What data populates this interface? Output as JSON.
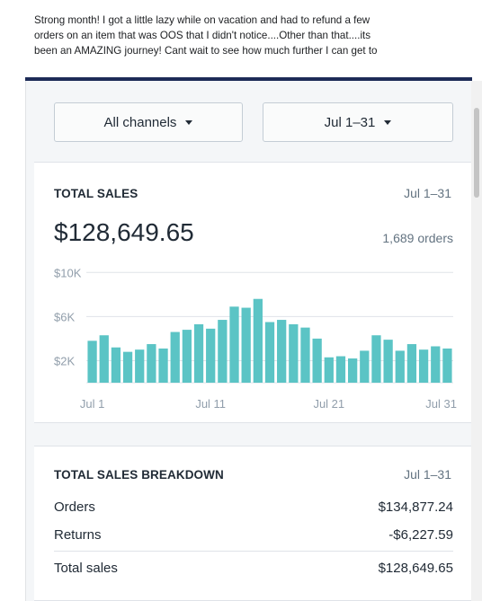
{
  "post": {
    "lines": [
      "Strong month! I got a little lazy while on vacation and had to refund a few",
      "orders on an item that was OOS that I didn't notice....Other than that....its",
      "been an AMAZING journey! Cant wait to see how much further I can get to"
    ]
  },
  "filters": {
    "channel": "All channels",
    "date_range": "Jul 1–31"
  },
  "total_sales": {
    "title": "TOTAL SALES",
    "date": "Jul 1–31",
    "amount": "$128,649.65",
    "orders": "1,689 orders"
  },
  "chart_data": {
    "type": "bar",
    "categories": [
      "Jul 1",
      "Jul 2",
      "Jul 3",
      "Jul 4",
      "Jul 5",
      "Jul 6",
      "Jul 7",
      "Jul 8",
      "Jul 9",
      "Jul 10",
      "Jul 11",
      "Jul 12",
      "Jul 13",
      "Jul 14",
      "Jul 15",
      "Jul 16",
      "Jul 17",
      "Jul 18",
      "Jul 19",
      "Jul 20",
      "Jul 21",
      "Jul 22",
      "Jul 23",
      "Jul 24",
      "Jul 25",
      "Jul 26",
      "Jul 27",
      "Jul 28",
      "Jul 29",
      "Jul 30",
      "Jul 31"
    ],
    "values": [
      3800,
      4300,
      3200,
      2800,
      3000,
      3500,
      3100,
      4600,
      4800,
      5300,
      4900,
      5700,
      6900,
      6800,
      7600,
      5500,
      5700,
      5300,
      5000,
      4000,
      2300,
      2400,
      2200,
      2900,
      4300,
      3900,
      2900,
      3500,
      3000,
      3300,
      3100
    ],
    "x_tick_labels": [
      "Jul 1",
      "Jul 11",
      "Jul 21",
      "Jul 31"
    ],
    "y_tick_labels": [
      "$10K",
      "$6K",
      "$2K"
    ],
    "y_ticks": [
      10000,
      6000,
      2000
    ],
    "ylim": [
      0,
      11000
    ],
    "bar_color": "#5bc4c5",
    "grid": true
  },
  "breakdown": {
    "title": "TOTAL SALES BREAKDOWN",
    "date": "Jul 1–31",
    "rows": [
      {
        "label": "Orders",
        "value": "$134,877.24"
      },
      {
        "label": "Returns",
        "value": "-$6,227.59"
      },
      {
        "label": "Total sales",
        "value": "$128,649.65"
      }
    ]
  }
}
